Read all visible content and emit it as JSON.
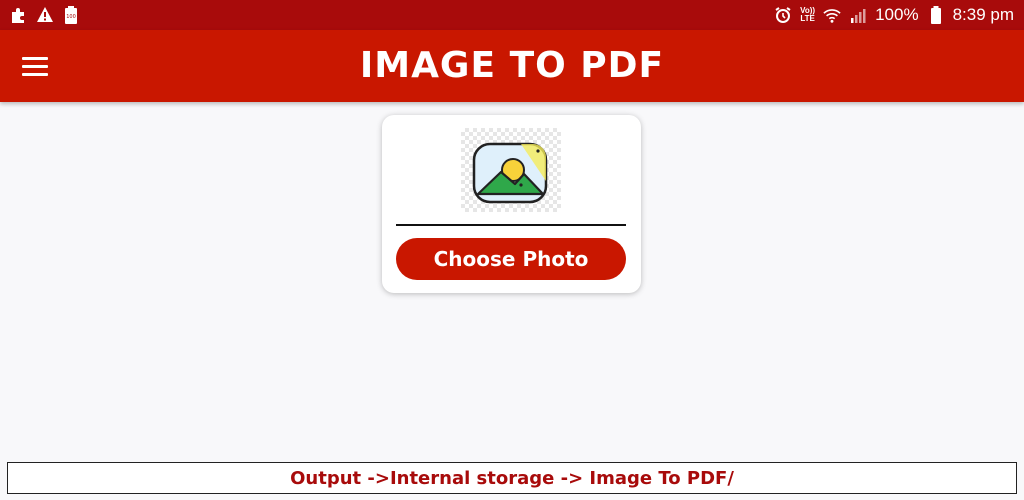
{
  "status_bar": {
    "left_icons": [
      "puzzle-icon",
      "warning-icon",
      "battery-saver-icon"
    ],
    "battery_saver_label": "100",
    "volte_top": "Vo))",
    "volte_bottom": "LTE",
    "battery_percent": "100%",
    "time": "8:39 pm"
  },
  "app_bar": {
    "title": "IMAGE TO PDF",
    "menu_icon": "menu-icon"
  },
  "card": {
    "preview_icon": "image-placeholder-icon",
    "choose_button_label": "Choose Photo"
  },
  "footer": {
    "output_text": "Output ->Internal storage -> Image To PDF/"
  },
  "colors": {
    "status_bar": "#a80b0b",
    "app_bar": "#c91700",
    "button": "#c91700",
    "footer_text": "#a80b0b"
  }
}
